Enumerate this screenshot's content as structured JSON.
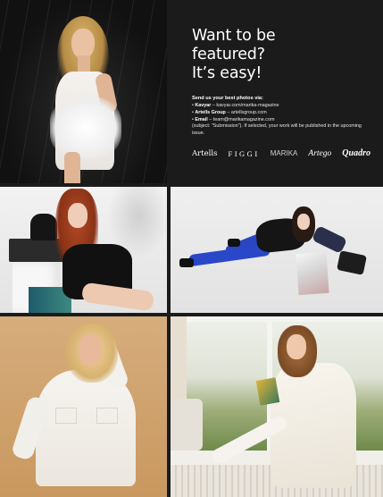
{
  "panel": {
    "headline": "Want to be\nfeatured?\nIt’s easy!",
    "intro": "Send us your best photos via:",
    "channels": [
      {
        "name": "Kavyar",
        "text": " – kavyar.com/marika-magazine"
      },
      {
        "name": "Artells Group",
        "text": " – artellsgroup.com"
      },
      {
        "name": "Email",
        "text": " – team@marikamagazine.com"
      }
    ],
    "note": "(subject: \"Submission\"). If selected, your work will be published in the upcoming issue."
  },
  "logos": {
    "artells": "Artells",
    "figgi": "FIGGI",
    "marika": "MARIKA",
    "artego": "Artego",
    "quadro": "Quadro"
  },
  "colors": {
    "background": "#1b1b1b",
    "text": "#ffffff"
  }
}
